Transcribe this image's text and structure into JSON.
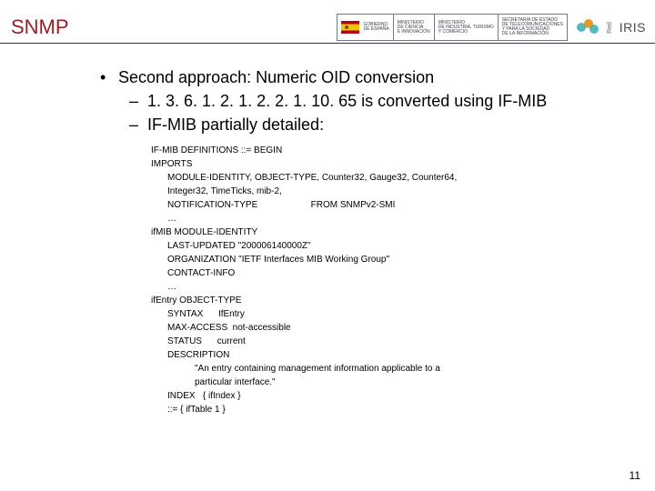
{
  "title": "SNMP",
  "page_number": "11",
  "logos": {
    "gob": "GOBIERNO\nDE ESPAÑA",
    "min1": "MINISTERIO\nDE CIENCIA\nE INNOVACIÓN",
    "min2": "MINISTERIO\nDE INDUSTRIA, TURISMO\nY COMERCIO",
    "sec": "SECRETARÍA DE ESTADO\nDE TELECOMUNICACIONES\nY PARA LA SOCIEDAD\nDE LA INFORMACIÓN",
    "iris_red": "Red",
    "iris_word": "IRIS"
  },
  "bullet": "Second approach: Numeric OID conversion",
  "sub1": "1. 3. 6. 1. 2. 1. 2. 2. 1. 10. 65 is converted using IF-MIB",
  "sub2": "IF-MIB partially detailed:",
  "code": {
    "l01": "IF-MIB DEFINITIONS ::= BEGIN",
    "l02": "IMPORTS",
    "l03": "MODULE-IDENTITY, OBJECT-TYPE, Counter32, Gauge32, Counter64,",
    "l04": "Integer32, TimeTicks, mib-2,",
    "l05a": "NOTIFICATION-TYPE",
    "l05b": "FROM SNMPv2-SMI",
    "l06": "…",
    "l07": "ifMIB MODULE-IDENTITY",
    "l08": "LAST-UPDATED \"200006140000Z\"",
    "l09": "ORGANIZATION \"IETF Interfaces MIB Working Group\"",
    "l10": "CONTACT-INFO",
    "l11": "…",
    "l12": "ifEntry OBJECT-TYPE",
    "l13": "SYNTAX      IfEntry",
    "l14": "MAX-ACCESS  not-accessible",
    "l15": "STATUS      current",
    "l16": "DESCRIPTION",
    "l17": "\"An entry containing management information applicable to a",
    "l18": "particular interface.\"",
    "l19": "INDEX   { ifIndex }",
    "l20": "::= { ifTable 1 }"
  }
}
